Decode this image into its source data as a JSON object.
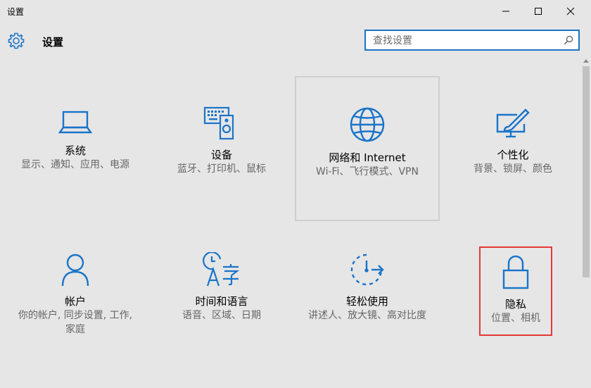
{
  "window": {
    "title": "设置",
    "controls": {
      "minimize": "–",
      "maximize": "☐",
      "close": "✕"
    }
  },
  "header": {
    "title": "设置",
    "icon": "gear-icon"
  },
  "search": {
    "placeholder": "查找设置",
    "value": "",
    "icon": "search-icon"
  },
  "colors": {
    "accent": "#1a74c9",
    "background": "#e6e6e6",
    "highlight_border": "#e53935",
    "description_text": "#666666"
  },
  "tiles": [
    {
      "name": "系统",
      "description": "显示、通知、应用、电源",
      "icon": "laptop-icon"
    },
    {
      "name": "设备",
      "description": "蓝牙、打印机、鼠标",
      "icon": "devices-icon"
    },
    {
      "name": "网络和 Internet",
      "description": "Wi-Fi、飞行模式、VPN",
      "icon": "globe-icon"
    },
    {
      "name": "个性化",
      "description": "背景、锁屏、颜色",
      "icon": "personalization-icon"
    },
    {
      "name": "帐户",
      "description": "你的帐户, 同步设置, 工作, 家庭",
      "icon": "person-icon"
    },
    {
      "name": "时间和语言",
      "description": "语音、区域、日期",
      "icon": "time-language-icon"
    },
    {
      "name": "轻松使用",
      "description": "讲述人、放大镜、高对比度",
      "icon": "ease-of-access-icon"
    },
    {
      "name": "隐私",
      "description": "位置、相机",
      "icon": "lock-icon"
    }
  ]
}
